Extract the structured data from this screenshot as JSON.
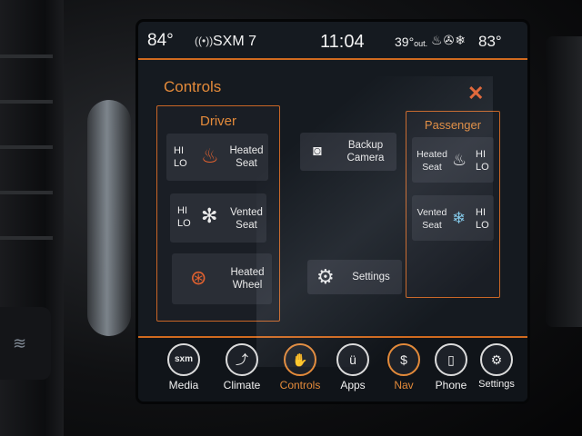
{
  "status_bar": {
    "interior_temp": "84°",
    "radio_station": "SXM 7",
    "clock": "11:04",
    "outside_temp": "39°",
    "outside_label": "out.",
    "right_temp": "83°"
  },
  "page": {
    "title": "Controls",
    "close_glyph": "✕"
  },
  "driver": {
    "title": "Driver",
    "heated_seat": {
      "hi": "HI",
      "lo": "LO",
      "label_line1": "Heated",
      "label_line2": "Seat"
    },
    "vented_seat": {
      "hi": "HI",
      "lo": "LO",
      "label_line1": "Vented",
      "label_line2": "Seat"
    },
    "heated_wheel": {
      "label_line1": "Heated",
      "label_line2": "Wheel"
    }
  },
  "center": {
    "backup_camera": {
      "label_line1": "Backup",
      "label_line2": "Camera"
    },
    "settings": {
      "label": "Settings"
    }
  },
  "passenger": {
    "title": "Passenger",
    "heated_seat": {
      "hi": "HI",
      "lo": "LO",
      "label_line1": "Heated",
      "label_line2": "Seat"
    },
    "vented_seat": {
      "hi": "HI",
      "lo": "LO",
      "label_line1": "Vented",
      "label_line2": "Seat"
    }
  },
  "nav": {
    "items": [
      {
        "label": "Media",
        "icon": "sxm-icon",
        "glyph": "sxm"
      },
      {
        "label": "Climate",
        "icon": "climate-icon",
        "glyph": "⤴"
      },
      {
        "label": "Controls",
        "icon": "controls-icon",
        "glyph": "✋"
      },
      {
        "label": "Apps",
        "icon": "apps-icon",
        "glyph": "ü"
      },
      {
        "label": "Nav",
        "icon": "nav-icon",
        "glyph": "$"
      },
      {
        "label": "Phone",
        "icon": "phone-icon",
        "glyph": "▯"
      },
      {
        "label": "Settings",
        "icon": "gear-icon",
        "glyph": "⚙"
      }
    ],
    "active": "Controls"
  },
  "colors": {
    "accent": "#e38a3a",
    "close": "#e2612f",
    "screen_bg": "#151a20"
  }
}
